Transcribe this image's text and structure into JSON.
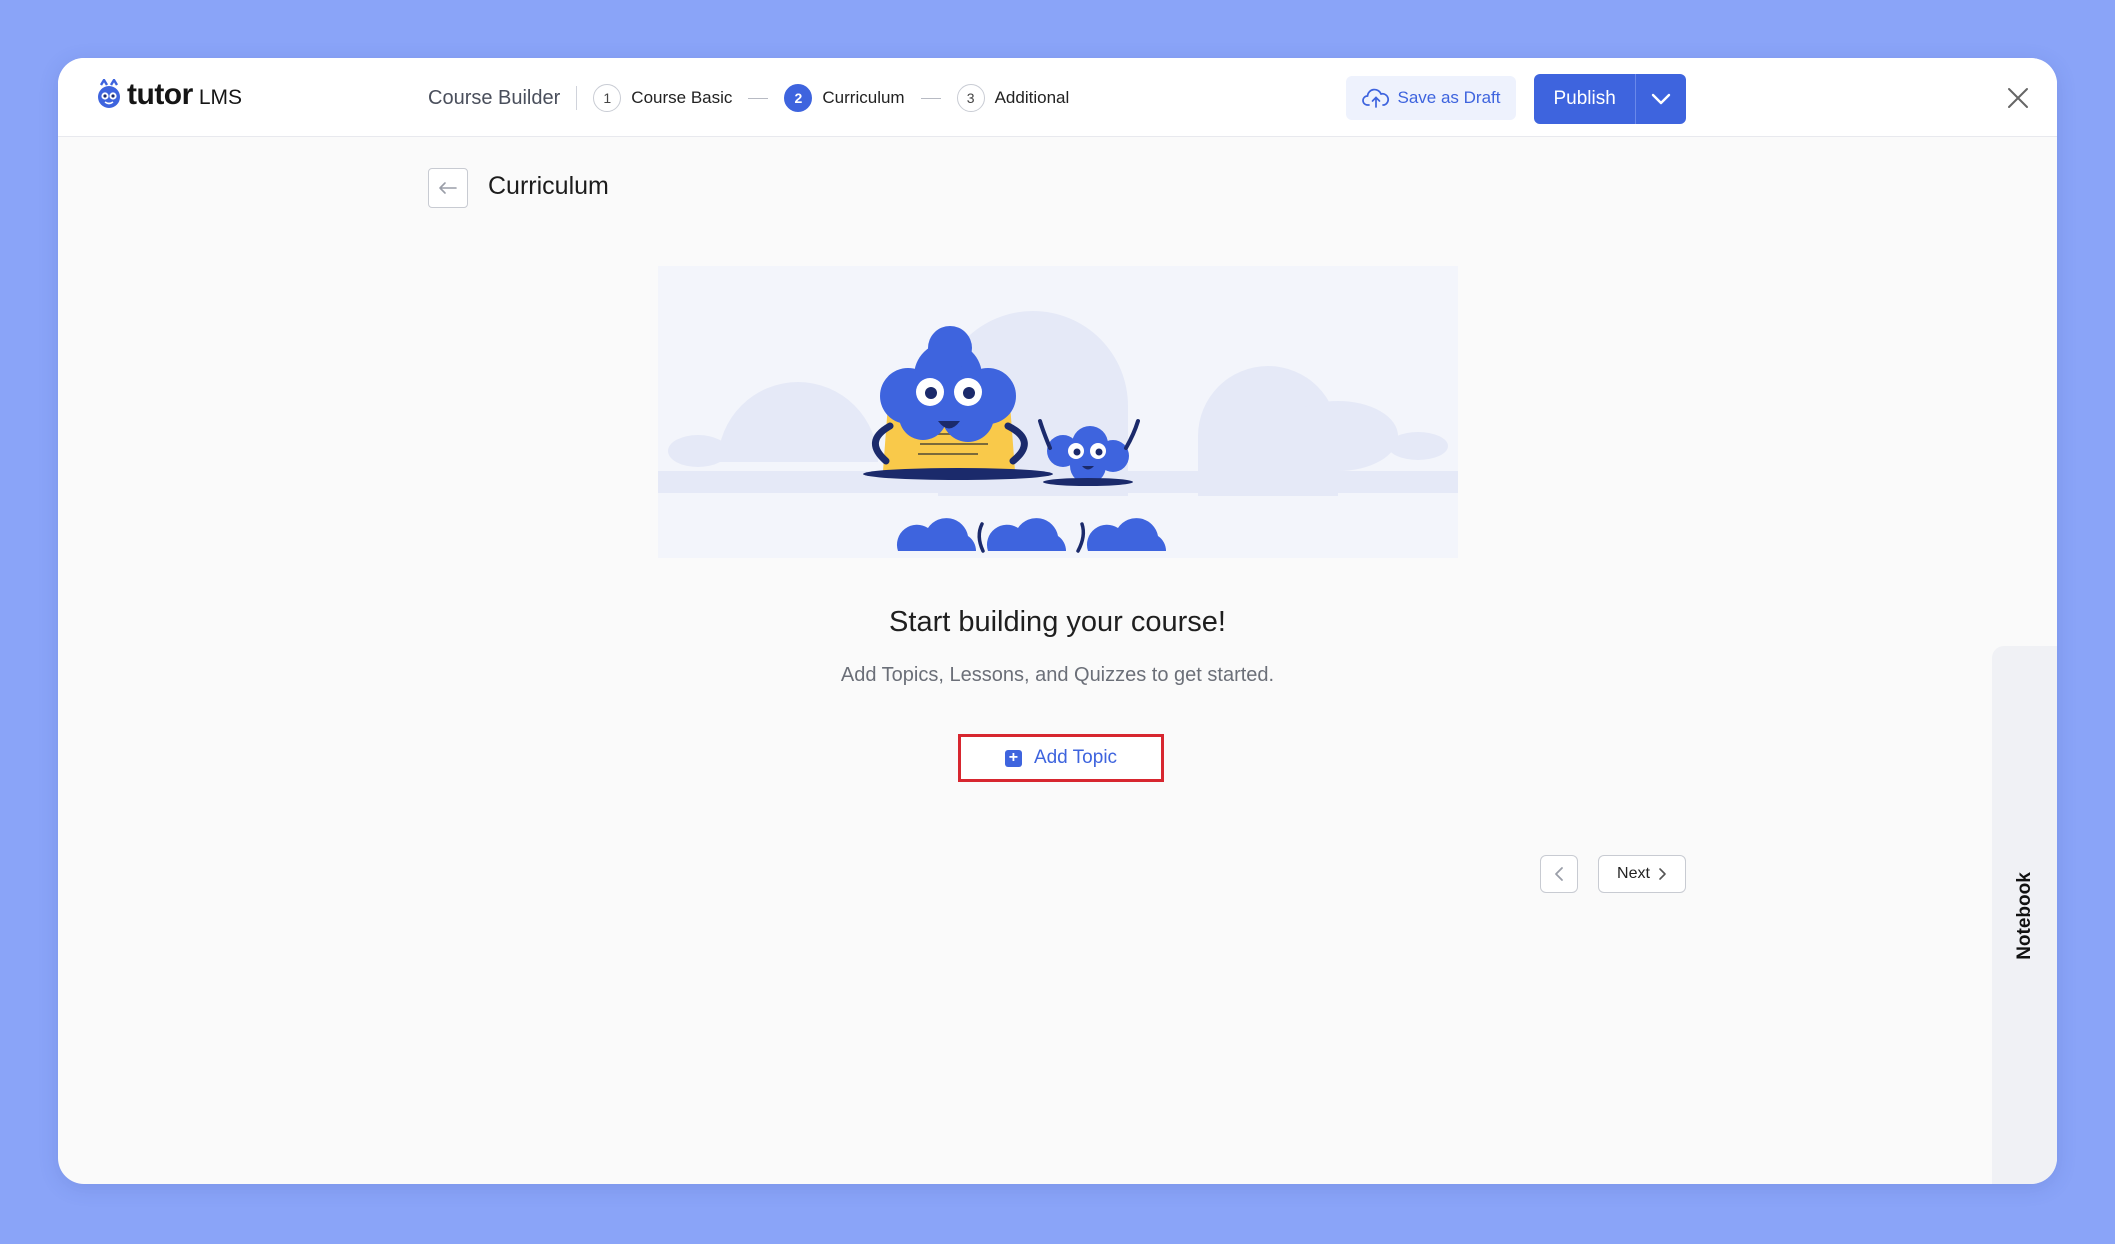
{
  "app": {
    "logo_text": "tutor",
    "logo_suffix": "LMS"
  },
  "header": {
    "builder_title": "Course Builder",
    "steps": [
      {
        "number": "1",
        "label": "Course Basic",
        "active": false
      },
      {
        "number": "2",
        "label": "Curriculum",
        "active": true
      },
      {
        "number": "3",
        "label": "Additional",
        "active": false
      }
    ],
    "save_draft_label": "Save as Draft",
    "publish_label": "Publish"
  },
  "page": {
    "title": "Curriculum"
  },
  "empty_state": {
    "headline": "Start building your course!",
    "subline": "Add Topics, Lessons, and Quizzes to get started.",
    "add_topic_label": "Add Topic"
  },
  "nav": {
    "next_label": "Next"
  },
  "notebook": {
    "label": "Notebook"
  },
  "colors": {
    "accent": "#3e64de",
    "highlight": "#d7262f",
    "background": "#8aa4f8"
  }
}
